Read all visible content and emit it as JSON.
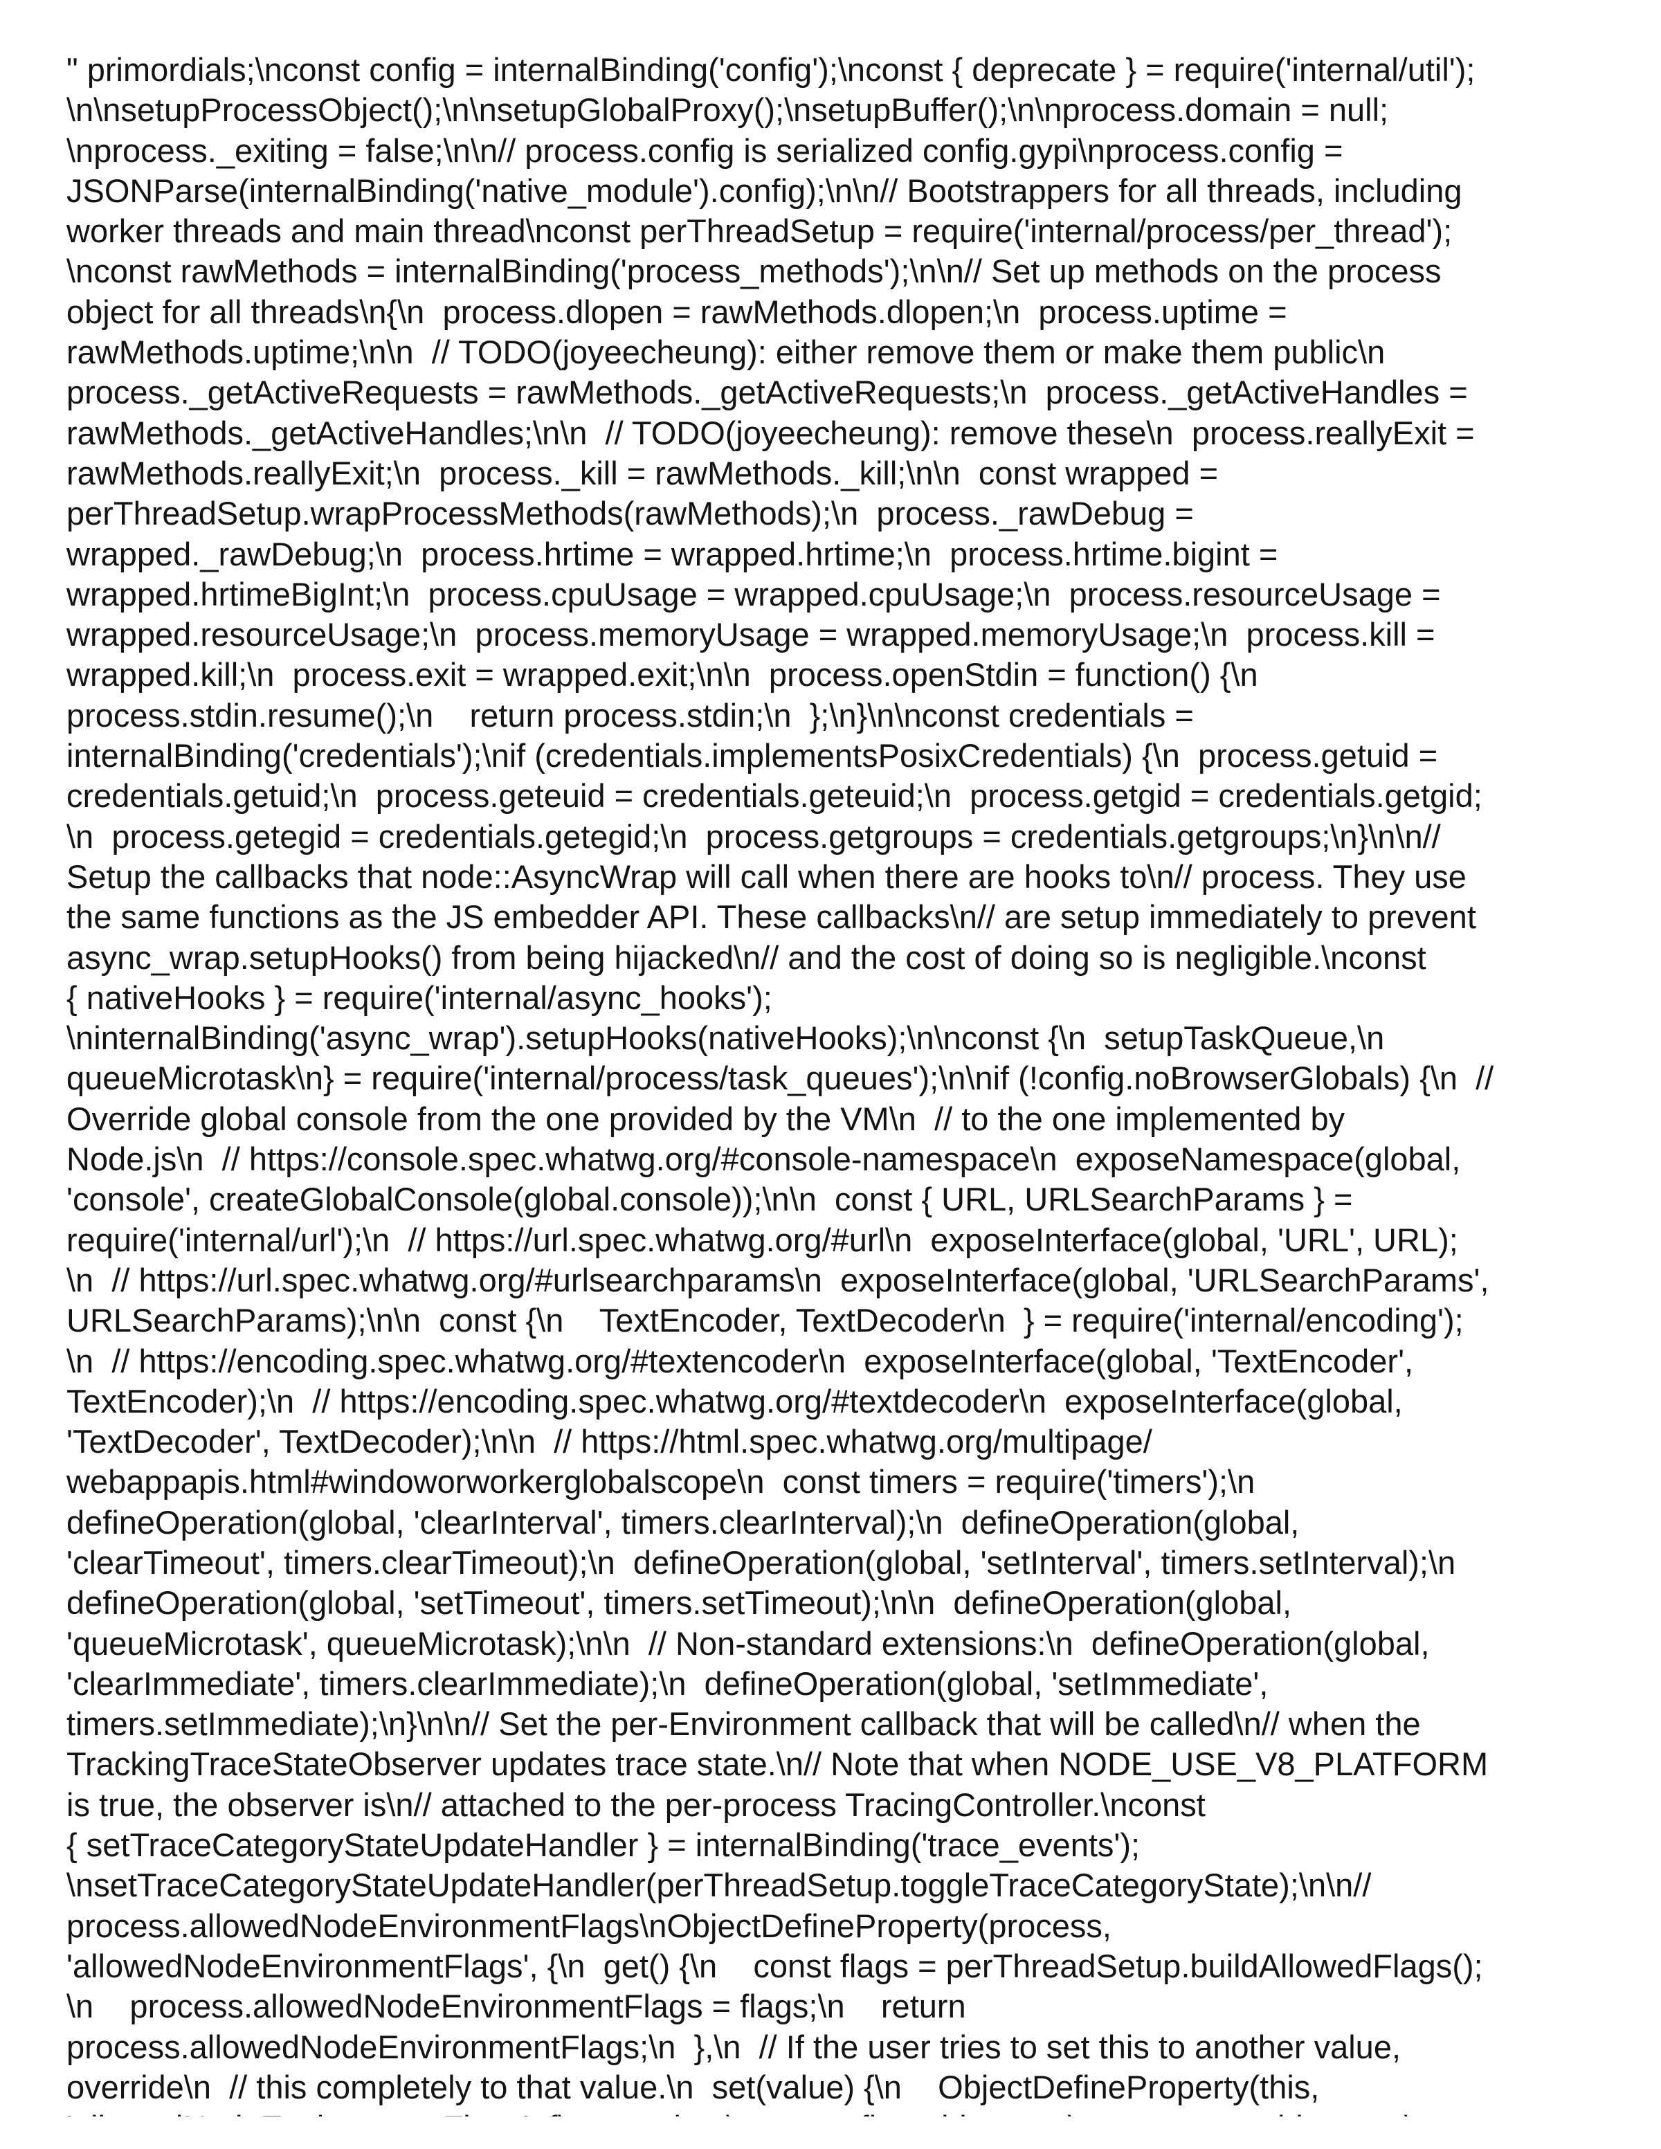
{
  "document": {
    "lines": [
      "\" primordials;\\nconst config = internalBinding('config');\\nconst { deprecate } = require('internal/util');",
      "\\n\\nsetupProcessObject();\\n\\nsetupGlobalProxy();\\nsetupBuffer();\\n\\nprocess.domain = null;",
      "\\nprocess._exiting = false;\\n\\n// process.config is serialized config.gypi\\nprocess.config =",
      "JSONParse(internalBinding('native_module').config);\\n\\n// Bootstrappers for all threads, including",
      "worker threads and main thread\\nconst perThreadSetup = require('internal/process/per_thread');",
      "\\nconst rawMethods = internalBinding('process_methods');\\n\\n// Set up methods on the process",
      "object for all threads\\n{\\n  process.dlopen = rawMethods.dlopen;\\n  process.uptime =",
      "rawMethods.uptime;\\n\\n  // TODO(joyeecheung): either remove them or make them public\\n",
      "process._getActiveRequests = rawMethods._getActiveRequests;\\n  process._getActiveHandles =",
      "rawMethods._getActiveHandles;\\n\\n  // TODO(joyeecheung): remove these\\n  process.reallyExit =",
      "rawMethods.reallyExit;\\n  process._kill = rawMethods._kill;\\n\\n  const wrapped =",
      "perThreadSetup.wrapProcessMethods(rawMethods);\\n  process._rawDebug =",
      "wrapped._rawDebug;\\n  process.hrtime = wrapped.hrtime;\\n  process.hrtime.bigint =",
      "wrapped.hrtimeBigInt;\\n  process.cpuUsage = wrapped.cpuUsage;\\n  process.resourceUsage =",
      "wrapped.resourceUsage;\\n  process.memoryUsage = wrapped.memoryUsage;\\n  process.kill =",
      "wrapped.kill;\\n  process.exit = wrapped.exit;\\n\\n  process.openStdin = function() {\\n",
      "process.stdin.resume();\\n    return process.stdin;\\n  };\\n}\\n\\nconst credentials =",
      "internalBinding('credentials');\\nif (credentials.implementsPosixCredentials) {\\n  process.getuid =",
      "credentials.getuid;\\n  process.geteuid = credentials.geteuid;\\n  process.getgid = credentials.getgid;",
      "\\n  process.getegid = credentials.getegid;\\n  process.getgroups = credentials.getgroups;\\n}\\n\\n//",
      "Setup the callbacks that node::AsyncWrap will call when there are hooks to\\n// process. They use",
      "the same functions as the JS embedder API. These callbacks\\n// are setup immediately to prevent",
      "async_wrap.setupHooks() from being hijacked\\n// and the cost of doing so is negligible.\\nconst",
      "{ nativeHooks } = require('internal/async_hooks');",
      "\\ninternalBinding('async_wrap').setupHooks(nativeHooks);\\n\\nconst {\\n  setupTaskQueue,\\n",
      "queueMicrotask\\n} = require('internal/process/task_queues');\\n\\nif (!config.noBrowserGlobals) {\\n  //",
      "Override global console from the one provided by the VM\\n  // to the one implemented by",
      "Node.js\\n  // https://console.spec.whatwg.org/#console-namespace\\n  exposeNamespace(global,",
      "'console', createGlobalConsole(global.console));\\n\\n  const { URL, URLSearchParams } =",
      "require('internal/url');\\n  // https://url.spec.whatwg.org/#url\\n  exposeInterface(global, 'URL', URL);",
      "\\n  // https://url.spec.whatwg.org/#urlsearchparams\\n  exposeInterface(global, 'URLSearchParams',",
      "URLSearchParams);\\n\\n  const {\\n    TextEncoder, TextDecoder\\n  } = require('internal/encoding');",
      "\\n  // https://encoding.spec.whatwg.org/#textencoder\\n  exposeInterface(global, 'TextEncoder',",
      "TextEncoder);\\n  // https://encoding.spec.whatwg.org/#textdecoder\\n  exposeInterface(global,",
      "'TextDecoder', TextDecoder);\\n\\n  // https://html.spec.whatwg.org/multipage/",
      "webappapis.html#windoworworkerglobalscope\\n  const timers = require('timers');\\n",
      "defineOperation(global, 'clearInterval', timers.clearInterval);\\n  defineOperation(global,",
      "'clearTimeout', timers.clearTimeout);\\n  defineOperation(global, 'setInterval', timers.setInterval);\\n",
      "defineOperation(global, 'setTimeout', timers.setTimeout);\\n\\n  defineOperation(global,",
      "'queueMicrotask', queueMicrotask);\\n\\n  // Non-standard extensions:\\n  defineOperation(global,",
      "'clearImmediate', timers.clearImmediate);\\n  defineOperation(global, 'setImmediate',",
      "timers.setImmediate);\\n}\\n\\n// Set the per-Environment callback that will be called\\n// when the",
      "TrackingTraceStateObserver updates trace state.\\n// Note that when NODE_USE_V8_PLATFORM",
      "is true, the observer is\\n// attached to the per-process TracingController.\\nconst",
      "{ setTraceCategoryStateUpdateHandler } = internalBinding('trace_events');",
      "\\nsetTraceCategoryStateUpdateHandler(perThreadSetup.toggleTraceCategoryState);\\n\\n//",
      "process.allowedNodeEnvironmentFlags\\nObjectDefineProperty(process,",
      "'allowedNodeEnvironmentFlags', {\\n  get() {\\n    const flags = perThreadSetup.buildAllowedFlags();",
      "\\n    process.allowedNodeEnvironmentFlags = flags;\\n    return",
      "process.allowedNodeEnvironmentFlags;\\n  },\\n  // If the user tries to set this to another value,",
      "override\\n  // this completely to that value.\\n  set(value) {\\n    ObjectDefineProperty(this,",
      "'allowedNodeEnvironmentFlags', {\\n      value,\\n      configurable: true,\\n      enumerable: true,\\n"
    ]
  }
}
